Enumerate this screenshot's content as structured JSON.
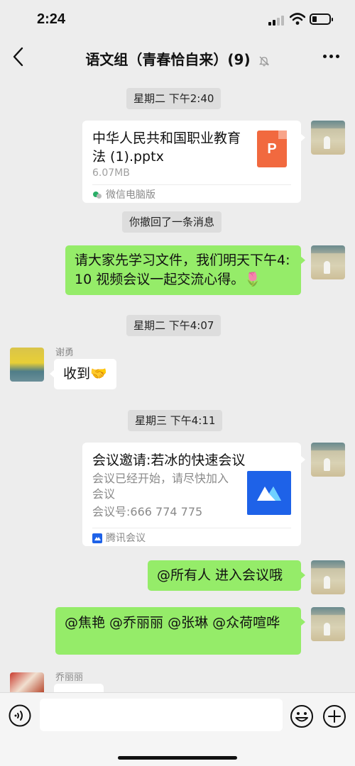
{
  "status": {
    "time": "2:24"
  },
  "header": {
    "title": "语文组（青春恰自来）(9)",
    "back": "back"
  },
  "messages": {
    "stamp1": "星期二 下午2:40",
    "file": {
      "name": "中华人民共和国职业教育法 (1).pptx",
      "size": "6.07MB",
      "source": "微信电脑版",
      "icon_letter": "P"
    },
    "recall": "你撤回了一条消息",
    "announce": "请大家先学习文件，我们明天下午4:10 视频会议一起交流心得。🌷",
    "stamp2": "星期二 下午4:07",
    "sender1": "谢勇",
    "reply1": "收到🤝",
    "stamp3": "星期三 下午4:11",
    "meeting": {
      "title": "会议邀请:若冰的快速会议",
      "desc": "会议已经开始，请尽快加入会议",
      "id": "会议号:666 774 775",
      "source": "腾讯会议"
    },
    "mention_all": "@所有人 进入会议哦",
    "mentions": "@焦艳 @乔丽丽 @张琳 @众荷喧哗",
    "sender2": "乔丽丽"
  },
  "input": {
    "placeholder": ""
  },
  "colors": {
    "self_bubble": "#95ec69",
    "background": "#ededed",
    "meeting_brand": "#1e62e8",
    "ppt_icon": "#f1693f"
  }
}
